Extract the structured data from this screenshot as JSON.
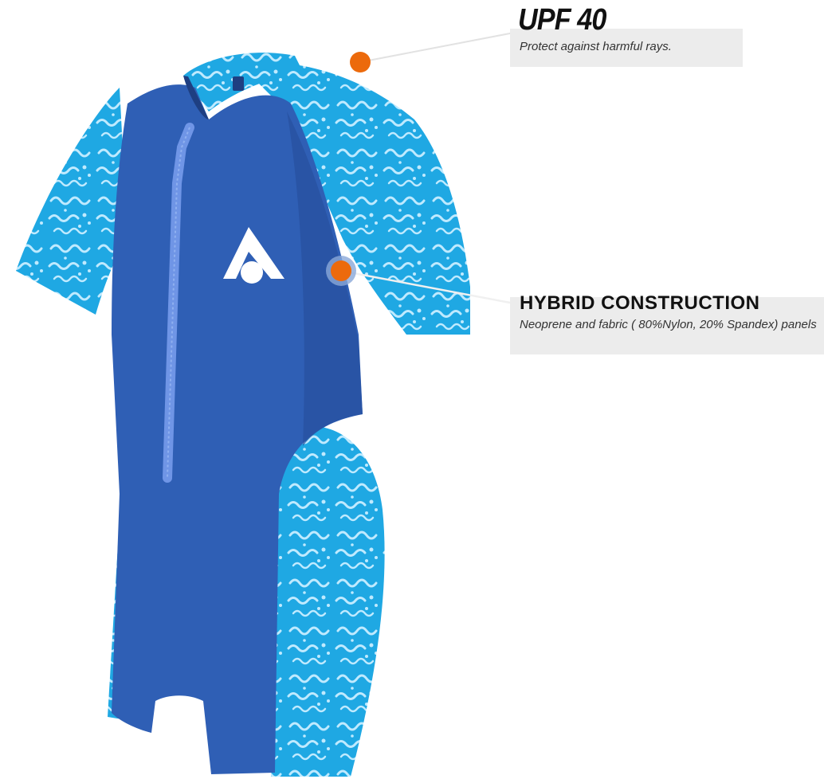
{
  "colors": {
    "body_navy": "#2f5fb5",
    "print_cyan": "#1fa8e3",
    "accent_orange": "#ec6a0c",
    "callout_bg": "#ececec"
  },
  "callouts": {
    "upf": {
      "title": "UPF 40",
      "text": "Protect against harmful rays."
    },
    "hybrid": {
      "title": "HYBRID CONSTRUCTION",
      "text": "Neoprene and fabric ( 80%Nylon, 20% Spandex) panels"
    }
  },
  "product": {
    "icons": [
      "brand-logo-icon",
      "zipper-icon",
      "hotspot-dot-icon"
    ]
  }
}
